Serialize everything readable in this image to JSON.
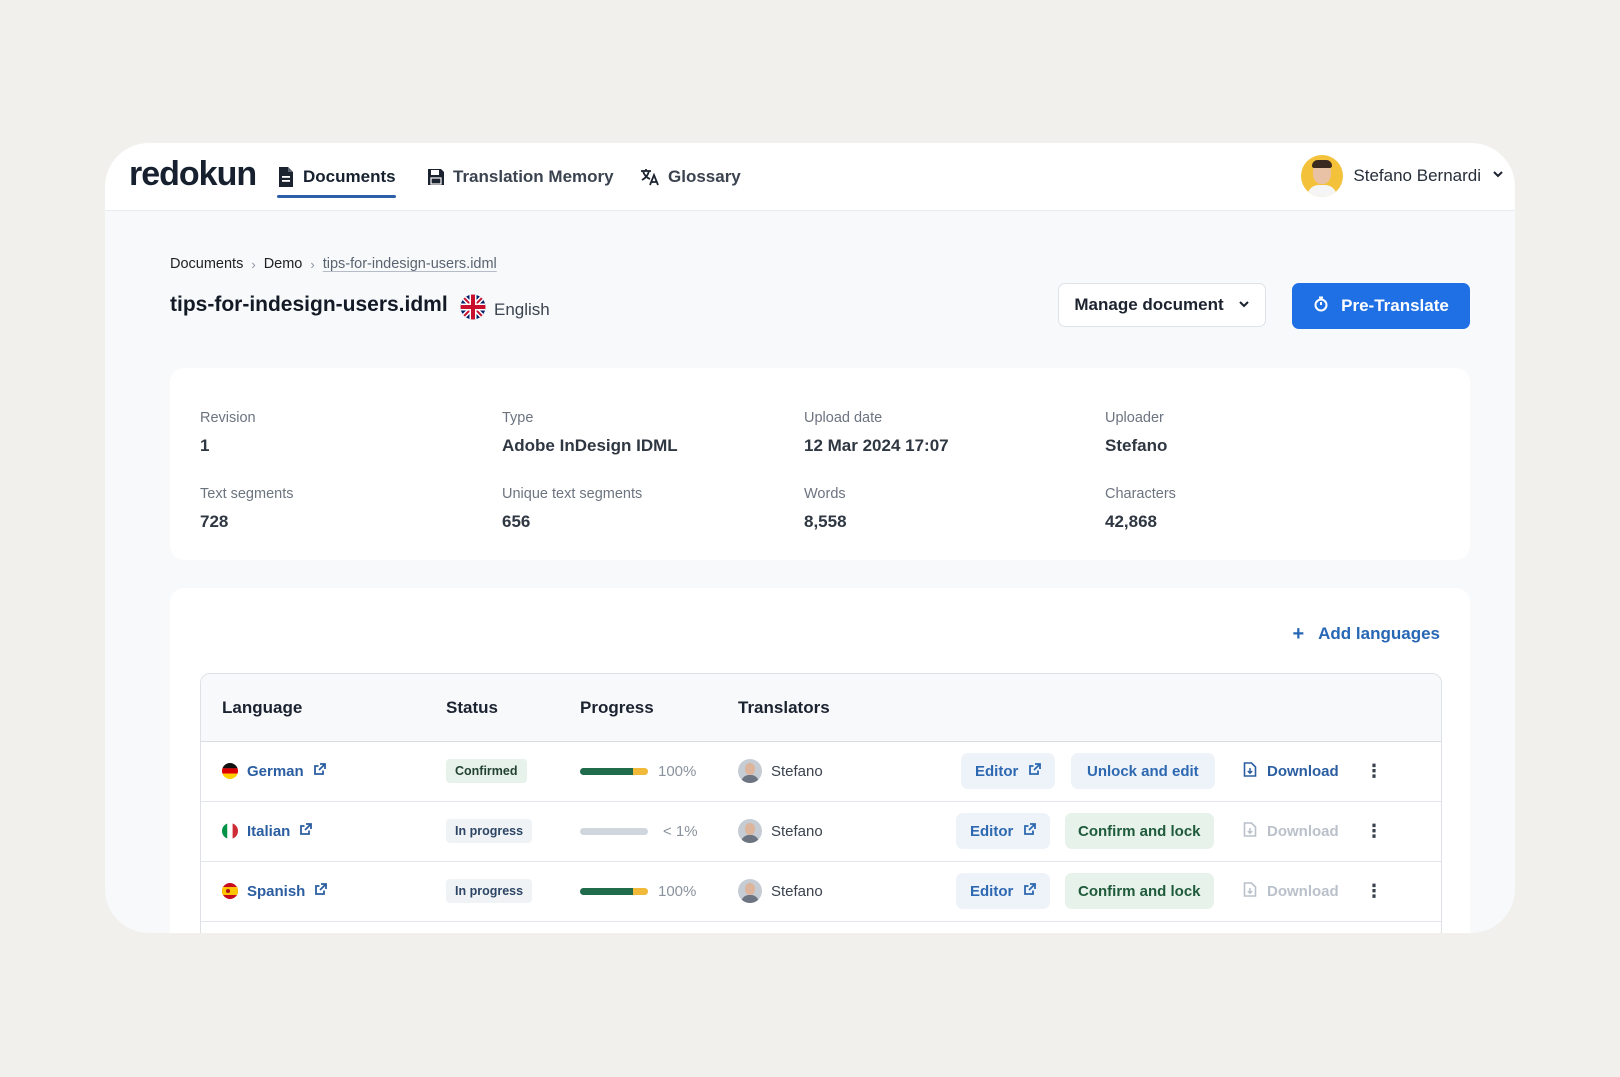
{
  "app": {
    "logo": "redokun"
  },
  "nav": {
    "documents": "Documents",
    "translation_memory": "Translation Memory",
    "glossary": "Glossary"
  },
  "user": {
    "name": "Stefano Bernardi"
  },
  "breadcrumb": [
    "Documents",
    "Demo",
    "tips-for-indesign-users.idml"
  ],
  "document": {
    "title": "tips-for-indesign-users.idml",
    "source_language": "English"
  },
  "actions": {
    "manage": "Manage document",
    "pretranslate": "Pre-Translate"
  },
  "stats": [
    {
      "label": "Revision",
      "value": "1"
    },
    {
      "label": "Type",
      "value": "Adobe InDesign IDML"
    },
    {
      "label": "Upload date",
      "value": "12 Mar 2024 17:07"
    },
    {
      "label": "Uploader",
      "value": "Stefano"
    },
    {
      "label": "Text segments",
      "value": "728"
    },
    {
      "label": "Unique text segments",
      "value": "656"
    },
    {
      "label": "Words",
      "value": "8,558"
    },
    {
      "label": "Characters",
      "value": "42,868"
    }
  ],
  "languages": {
    "add_label": "Add languages",
    "columns": [
      "Language",
      "Status",
      "Progress",
      "Translators"
    ],
    "rows": [
      {
        "language": "German",
        "status": "Confirmed",
        "progress": 1.0,
        "progress_label": "100%",
        "translator": "Stefano",
        "editor": "Editor",
        "action": "Unlock and edit",
        "download": "Download",
        "download_enabled": true
      },
      {
        "language": "Italian",
        "status": "In progress",
        "progress": 0.0,
        "progress_label": "< 1%",
        "translator": "Stefano",
        "editor": "Editor",
        "action": "Confirm and lock",
        "download": "Download",
        "download_enabled": false
      },
      {
        "language": "Spanish",
        "status": "In progress",
        "progress": 1.0,
        "progress_label": "100%",
        "translator": "Stefano",
        "editor": "Editor",
        "action": "Confirm and lock",
        "download": "Download",
        "download_enabled": false
      }
    ]
  },
  "colors": {
    "accent": "#1f6fe5",
    "link": "#2b5ea1",
    "progress_fill": "#1f6b4b",
    "progress_tail": "#f0b93a"
  }
}
